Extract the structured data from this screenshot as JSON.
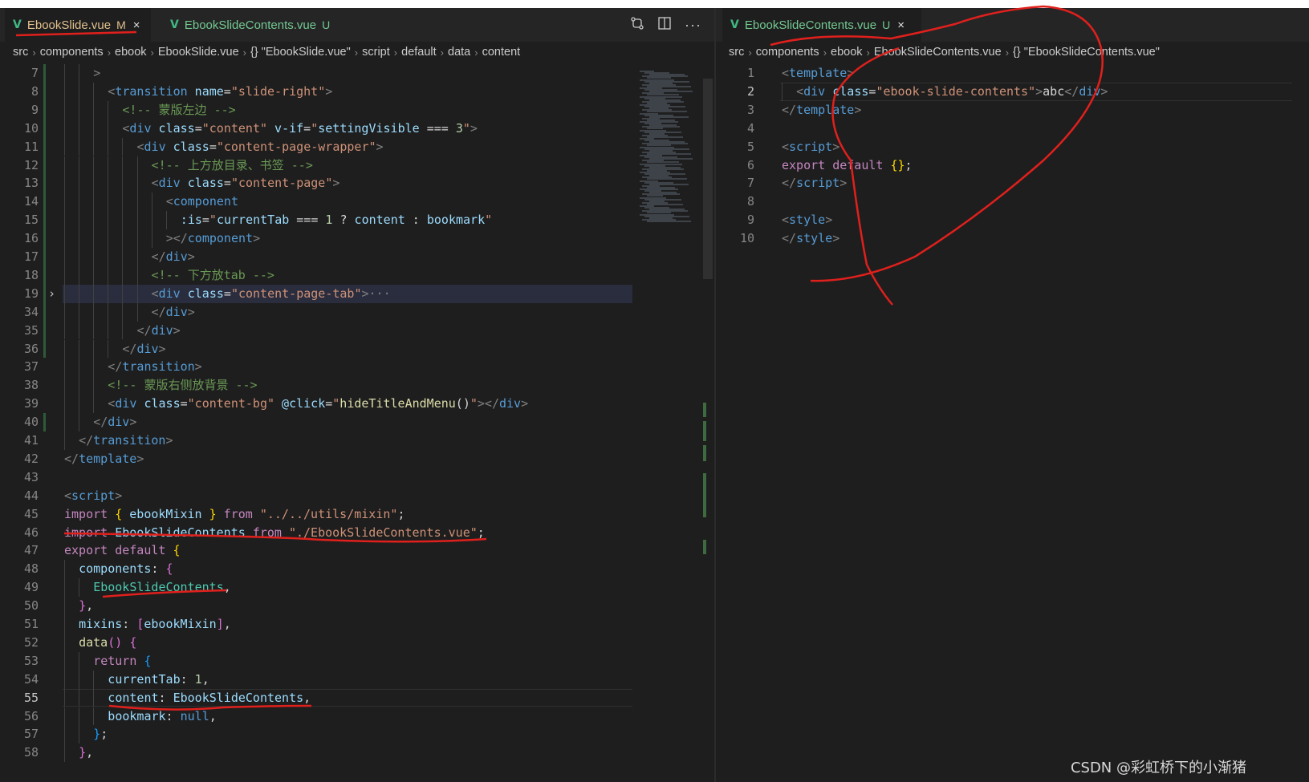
{
  "left_editor": {
    "tabs": [
      {
        "name": "EbookSlide.vue",
        "status": "M",
        "active": true,
        "close": "×"
      },
      {
        "name": "EbookSlideContents.vue",
        "status": "U",
        "active": false
      }
    ],
    "breadcrumb": [
      "src",
      "components",
      "ebook",
      "EbookSlide.vue",
      "{} \"EbookSlide.vue\"",
      "script",
      "default",
      "data",
      "content"
    ],
    "lines": [
      {
        "num": "7",
        "indent": 2,
        "spans": [
          {
            "t": ">",
            "c": "c-br"
          }
        ]
      },
      {
        "num": "8",
        "indent": 3,
        "spans": [
          {
            "t": "<",
            "c": "c-br"
          },
          {
            "t": "transition",
            "c": "c-tag"
          },
          {
            "t": " name",
            "c": "c-attr"
          },
          {
            "t": "=",
            "c": "c-plain"
          },
          {
            "t": "\"slide-right\"",
            "c": "c-str"
          },
          {
            "t": ">",
            "c": "c-br"
          }
        ]
      },
      {
        "num": "9",
        "indent": 4,
        "spans": [
          {
            "t": "<!-- 蒙版左边 -->",
            "c": "c-com"
          }
        ]
      },
      {
        "num": "10",
        "indent": 4,
        "spans": [
          {
            "t": "<",
            "c": "c-br"
          },
          {
            "t": "div",
            "c": "c-tag"
          },
          {
            "t": " class",
            "c": "c-attr"
          },
          {
            "t": "=",
            "c": "c-plain"
          },
          {
            "t": "\"content\"",
            "c": "c-str"
          },
          {
            "t": " v-if",
            "c": "c-attr"
          },
          {
            "t": "=",
            "c": "c-plain"
          },
          {
            "t": "\"",
            "c": "c-str"
          },
          {
            "t": "settingVisible",
            "c": "c-var"
          },
          {
            "t": " === ",
            "c": "c-plain"
          },
          {
            "t": "3",
            "c": "c-num"
          },
          {
            "t": "\"",
            "c": "c-str"
          },
          {
            "t": ">",
            "c": "c-br"
          }
        ]
      },
      {
        "num": "11",
        "indent": 5,
        "spans": [
          {
            "t": "<",
            "c": "c-br"
          },
          {
            "t": "div",
            "c": "c-tag"
          },
          {
            "t": " class",
            "c": "c-attr"
          },
          {
            "t": "=",
            "c": "c-plain"
          },
          {
            "t": "\"content-page-wrapper\"",
            "c": "c-str"
          },
          {
            "t": ">",
            "c": "c-br"
          }
        ]
      },
      {
        "num": "12",
        "indent": 6,
        "spans": [
          {
            "t": "<!-- 上方放目录、书签 -->",
            "c": "c-com"
          }
        ]
      },
      {
        "num": "13",
        "indent": 6,
        "spans": [
          {
            "t": "<",
            "c": "c-br"
          },
          {
            "t": "div",
            "c": "c-tag"
          },
          {
            "t": " class",
            "c": "c-attr"
          },
          {
            "t": "=",
            "c": "c-plain"
          },
          {
            "t": "\"content-page\"",
            "c": "c-str"
          },
          {
            "t": ">",
            "c": "c-br"
          }
        ]
      },
      {
        "num": "14",
        "indent": 7,
        "spans": [
          {
            "t": "<",
            "c": "c-br"
          },
          {
            "t": "component",
            "c": "c-tag"
          }
        ]
      },
      {
        "num": "15",
        "indent": 8,
        "spans": [
          {
            "t": ":is",
            "c": "c-attr"
          },
          {
            "t": "=",
            "c": "c-plain"
          },
          {
            "t": "\"",
            "c": "c-str"
          },
          {
            "t": "currentTab",
            "c": "c-var"
          },
          {
            "t": " === ",
            "c": "c-plain"
          },
          {
            "t": "1",
            "c": "c-num"
          },
          {
            "t": " ? ",
            "c": "c-plain"
          },
          {
            "t": "content",
            "c": "c-var"
          },
          {
            "t": " : ",
            "c": "c-plain"
          },
          {
            "t": "bookmark",
            "c": "c-var"
          },
          {
            "t": "\"",
            "c": "c-str"
          }
        ]
      },
      {
        "num": "16",
        "indent": 7,
        "spans": [
          {
            "t": "></",
            "c": "c-br"
          },
          {
            "t": "component",
            "c": "c-tag"
          },
          {
            "t": ">",
            "c": "c-br"
          }
        ]
      },
      {
        "num": "17",
        "indent": 6,
        "spans": [
          {
            "t": "</",
            "c": "c-br"
          },
          {
            "t": "div",
            "c": "c-tag"
          },
          {
            "t": ">",
            "c": "c-br"
          }
        ]
      },
      {
        "num": "18",
        "indent": 6,
        "spans": [
          {
            "t": "<!-- 下方放tab -->",
            "c": "c-com"
          }
        ]
      },
      {
        "num": "19",
        "indent": 6,
        "folded": true,
        "highlight": true,
        "spans": [
          {
            "t": "<",
            "c": "c-br"
          },
          {
            "t": "div",
            "c": "c-tag"
          },
          {
            "t": " class",
            "c": "c-attr"
          },
          {
            "t": "=",
            "c": "c-plain"
          },
          {
            "t": "\"content-page-tab\"",
            "c": "c-str"
          },
          {
            "t": ">",
            "c": "c-br"
          },
          {
            "t": "···",
            "c": "c-br"
          }
        ]
      },
      {
        "num": "34",
        "indent": 6,
        "spans": [
          {
            "t": "</",
            "c": "c-br"
          },
          {
            "t": "div",
            "c": "c-tag"
          },
          {
            "t": ">",
            "c": "c-br"
          }
        ]
      },
      {
        "num": "35",
        "indent": 5,
        "spans": [
          {
            "t": "</",
            "c": "c-br"
          },
          {
            "t": "div",
            "c": "c-tag"
          },
          {
            "t": ">",
            "c": "c-br"
          }
        ]
      },
      {
        "num": "36",
        "indent": 4,
        "spans": [
          {
            "t": "</",
            "c": "c-br"
          },
          {
            "t": "div",
            "c": "c-tag"
          },
          {
            "t": ">",
            "c": "c-br"
          }
        ]
      },
      {
        "num": "37",
        "indent": 3,
        "spans": [
          {
            "t": "</",
            "c": "c-br"
          },
          {
            "t": "transition",
            "c": "c-tag"
          },
          {
            "t": ">",
            "c": "c-br"
          }
        ]
      },
      {
        "num": "38",
        "indent": 3,
        "spans": [
          {
            "t": "<!-- 蒙版右侧放背景 -->",
            "c": "c-com"
          }
        ]
      },
      {
        "num": "39",
        "indent": 3,
        "spans": [
          {
            "t": "<",
            "c": "c-br"
          },
          {
            "t": "div",
            "c": "c-tag"
          },
          {
            "t": " class",
            "c": "c-attr"
          },
          {
            "t": "=",
            "c": "c-plain"
          },
          {
            "t": "\"content-bg\"",
            "c": "c-str"
          },
          {
            "t": " @click",
            "c": "c-attr"
          },
          {
            "t": "=",
            "c": "c-plain"
          },
          {
            "t": "\"",
            "c": "c-str"
          },
          {
            "t": "hideTitleAndMenu",
            "c": "c-fn"
          },
          {
            "t": "()",
            "c": "c-plain"
          },
          {
            "t": "\"",
            "c": "c-str"
          },
          {
            "t": "></",
            "c": "c-br"
          },
          {
            "t": "div",
            "c": "c-tag"
          },
          {
            "t": ">",
            "c": "c-br"
          }
        ]
      },
      {
        "num": "40",
        "indent": 2,
        "spans": [
          {
            "t": "</",
            "c": "c-br"
          },
          {
            "t": "div",
            "c": "c-tag"
          },
          {
            "t": ">",
            "c": "c-br"
          }
        ]
      },
      {
        "num": "41",
        "indent": 1,
        "spans": [
          {
            "t": "</",
            "c": "c-br"
          },
          {
            "t": "transition",
            "c": "c-tag"
          },
          {
            "t": ">",
            "c": "c-br"
          }
        ]
      },
      {
        "num": "42",
        "indent": 0,
        "spans": [
          {
            "t": "</",
            "c": "c-br"
          },
          {
            "t": "template",
            "c": "c-tag"
          },
          {
            "t": ">",
            "c": "c-br"
          }
        ]
      },
      {
        "num": "43",
        "indent": 0,
        "spans": []
      },
      {
        "num": "44",
        "indent": 0,
        "spans": [
          {
            "t": "<",
            "c": "c-br"
          },
          {
            "t": "script",
            "c": "c-tag"
          },
          {
            "t": ">",
            "c": "c-br"
          }
        ]
      },
      {
        "num": "45",
        "indent": 0,
        "spans": [
          {
            "t": "import",
            "c": "c-kw"
          },
          {
            "t": " ",
            "c": "c-plain"
          },
          {
            "t": "{",
            "c": "c-b1"
          },
          {
            "t": " ebookMixin ",
            "c": "c-var"
          },
          {
            "t": "}",
            "c": "c-b1"
          },
          {
            "t": " from ",
            "c": "c-kw"
          },
          {
            "t": "\"../../utils/mixin\"",
            "c": "c-str"
          },
          {
            "t": ";",
            "c": "c-plain"
          }
        ]
      },
      {
        "num": "46",
        "indent": 0,
        "spans": [
          {
            "t": "import",
            "c": "c-kw"
          },
          {
            "t": " EbookSlideContents",
            "c": "c-var"
          },
          {
            "t": " from ",
            "c": "c-kw"
          },
          {
            "t": "\"./EbookSlideContents.vue\"",
            "c": "c-str"
          },
          {
            "t": ";",
            "c": "c-plain"
          }
        ]
      },
      {
        "num": "47",
        "indent": 0,
        "spans": [
          {
            "t": "export",
            "c": "c-kw"
          },
          {
            "t": " default ",
            "c": "c-kw"
          },
          {
            "t": "{",
            "c": "c-b1"
          }
        ]
      },
      {
        "num": "48",
        "indent": 1,
        "spans": [
          {
            "t": "components",
            "c": "c-var"
          },
          {
            "t": ": ",
            "c": "c-plain"
          },
          {
            "t": "{",
            "c": "c-b2"
          }
        ]
      },
      {
        "num": "49",
        "indent": 2,
        "spans": [
          {
            "t": "EbookSlideContents",
            "c": "c-comp"
          },
          {
            "t": ",",
            "c": "c-plain"
          }
        ]
      },
      {
        "num": "50",
        "indent": 1,
        "spans": [
          {
            "t": "}",
            "c": "c-b2"
          },
          {
            "t": ",",
            "c": "c-plain"
          }
        ]
      },
      {
        "num": "51",
        "indent": 1,
        "spans": [
          {
            "t": "mixins",
            "c": "c-var"
          },
          {
            "t": ": ",
            "c": "c-plain"
          },
          {
            "t": "[",
            "c": "c-b2"
          },
          {
            "t": "ebookMixin",
            "c": "c-var"
          },
          {
            "t": "]",
            "c": "c-b2"
          },
          {
            "t": ",",
            "c": "c-plain"
          }
        ]
      },
      {
        "num": "52",
        "indent": 1,
        "spans": [
          {
            "t": "data",
            "c": "c-fn"
          },
          {
            "t": "() ",
            "c": "c-b2"
          },
          {
            "t": "{",
            "c": "c-b2"
          }
        ]
      },
      {
        "num": "53",
        "indent": 2,
        "spans": [
          {
            "t": "return",
            "c": "c-kw"
          },
          {
            "t": " ",
            "c": "c-plain"
          },
          {
            "t": "{",
            "c": "c-b3"
          }
        ]
      },
      {
        "num": "54",
        "indent": 3,
        "spans": [
          {
            "t": "currentTab",
            "c": "c-var"
          },
          {
            "t": ": ",
            "c": "c-plain"
          },
          {
            "t": "1",
            "c": "c-num"
          },
          {
            "t": ",",
            "c": "c-plain"
          }
        ]
      },
      {
        "num": "55",
        "indent": 3,
        "current": true,
        "spans": [
          {
            "t": "content",
            "c": "c-var"
          },
          {
            "t": ": ",
            "c": "c-plain"
          },
          {
            "t": "EbookSlideContents",
            "c": "c-var"
          },
          {
            "t": ",",
            "c": "c-plain"
          }
        ]
      },
      {
        "num": "56",
        "indent": 3,
        "spans": [
          {
            "t": "bookmark",
            "c": "c-var"
          },
          {
            "t": ": ",
            "c": "c-plain"
          },
          {
            "t": "null",
            "c": "c-kw2"
          },
          {
            "t": ",",
            "c": "c-plain"
          }
        ]
      },
      {
        "num": "57",
        "indent": 2,
        "spans": [
          {
            "t": "}",
            "c": "c-b3"
          },
          {
            "t": ";",
            "c": "c-plain"
          }
        ]
      },
      {
        "num": "58",
        "indent": 1,
        "spans": [
          {
            "t": "}",
            "c": "c-b2"
          },
          {
            "t": ",",
            "c": "c-plain"
          }
        ]
      }
    ]
  },
  "right_editor": {
    "tab": {
      "name": "EbookSlideContents.vue",
      "status": "U",
      "close": "×"
    },
    "breadcrumb": [
      "src",
      "components",
      "ebook",
      "EbookSlideContents.vue",
      "{} \"EbookSlideContents.vue\""
    ],
    "lines": [
      {
        "num": "1",
        "indent": 0,
        "spans": [
          {
            "t": "<",
            "c": "c-br"
          },
          {
            "t": "template",
            "c": "c-tag"
          },
          {
            "t": ">",
            "c": "c-br"
          }
        ]
      },
      {
        "num": "2",
        "indent": 1,
        "current": true,
        "spans": [
          {
            "t": "<",
            "c": "c-br"
          },
          {
            "t": "div",
            "c": "c-tag"
          },
          {
            "t": " class",
            "c": "c-attr"
          },
          {
            "t": "=",
            "c": "c-plain"
          },
          {
            "t": "\"ebook-slide-contents\"",
            "c": "c-str"
          },
          {
            "t": ">",
            "c": "c-br"
          },
          {
            "t": "abc",
            "c": "c-plain"
          },
          {
            "t": "</",
            "c": "c-br"
          },
          {
            "t": "div",
            "c": "c-tag"
          },
          {
            "t": ">",
            "c": "c-br"
          }
        ]
      },
      {
        "num": "3",
        "indent": 0,
        "spans": [
          {
            "t": "</",
            "c": "c-br"
          },
          {
            "t": "template",
            "c": "c-tag"
          },
          {
            "t": ">",
            "c": "c-br"
          }
        ]
      },
      {
        "num": "4",
        "indent": 0,
        "spans": []
      },
      {
        "num": "5",
        "indent": 0,
        "spans": [
          {
            "t": "<",
            "c": "c-br"
          },
          {
            "t": "script",
            "c": "c-tag"
          },
          {
            "t": ">",
            "c": "c-br"
          }
        ]
      },
      {
        "num": "6",
        "indent": 0,
        "spans": [
          {
            "t": "export",
            "c": "c-kw"
          },
          {
            "t": " default ",
            "c": "c-kw"
          },
          {
            "t": "{}",
            "c": "c-b1"
          },
          {
            "t": ";",
            "c": "c-plain"
          }
        ]
      },
      {
        "num": "7",
        "indent": 0,
        "spans": [
          {
            "t": "</",
            "c": "c-br"
          },
          {
            "t": "script",
            "c": "c-tag"
          },
          {
            "t": ">",
            "c": "c-br"
          }
        ]
      },
      {
        "num": "8",
        "indent": 0,
        "spans": []
      },
      {
        "num": "9",
        "indent": 0,
        "spans": [
          {
            "t": "<",
            "c": "c-br"
          },
          {
            "t": "style",
            "c": "c-tag"
          },
          {
            "t": ">",
            "c": "c-br"
          }
        ]
      },
      {
        "num": "10",
        "indent": 0,
        "spans": [
          {
            "t": "</",
            "c": "c-br"
          },
          {
            "t": "style",
            "c": "c-tag"
          },
          {
            "t": ">",
            "c": "c-br"
          }
        ]
      }
    ]
  },
  "toolbar_icons": [
    "compare-changes-icon",
    "split-editor-icon",
    "more-actions-icon"
  ],
  "watermark": "CSDN @彩虹桥下的小渐猪",
  "colors": {
    "vue_icon": "#41b883",
    "modified_status": "#e2c08d",
    "untracked_status": "#73c991",
    "annotation": "#e0201c"
  }
}
